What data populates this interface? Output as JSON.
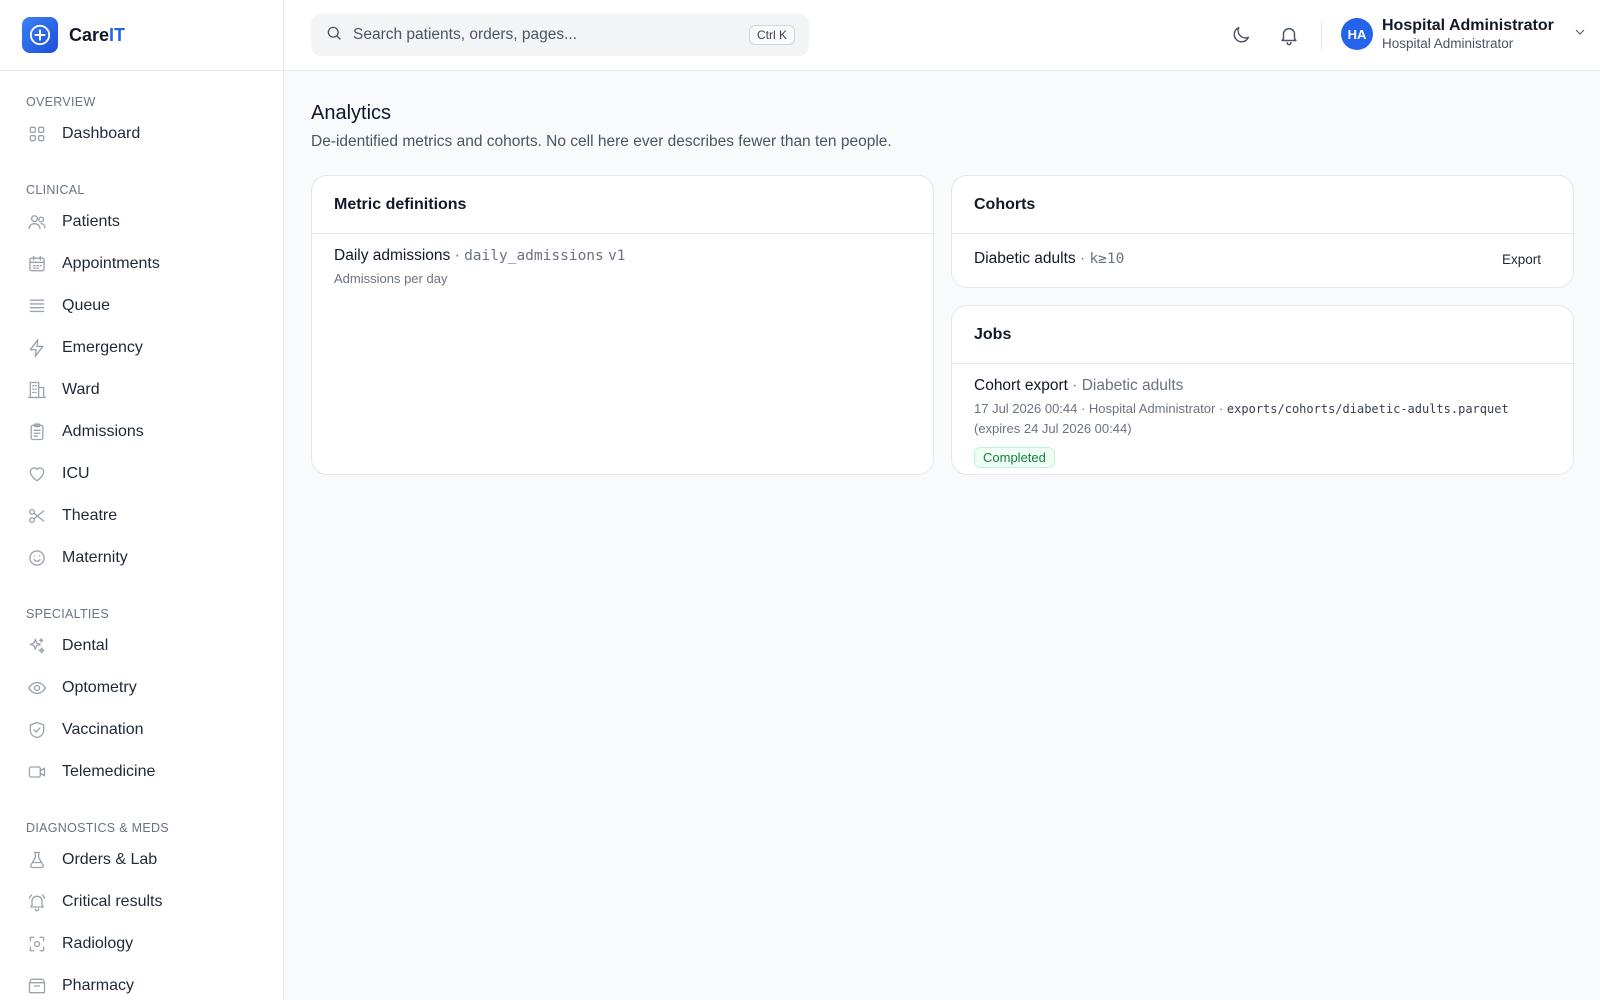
{
  "brand": {
    "name_main": "Care",
    "name_accent": "IT"
  },
  "search": {
    "placeholder": "Search patients, orders, pages...",
    "shortcut": "Ctrl K"
  },
  "user": {
    "initials": "HA",
    "name": "Hospital Administrator",
    "role": "Hospital Administrator"
  },
  "sidebar": {
    "sections": [
      {
        "title": "OVERVIEW",
        "items": [
          {
            "label": "Dashboard",
            "icon": "grid-icon"
          }
        ]
      },
      {
        "title": "CLINICAL",
        "items": [
          {
            "label": "Patients",
            "icon": "users-icon"
          },
          {
            "label": "Appointments",
            "icon": "calendar-icon"
          },
          {
            "label": "Queue",
            "icon": "list-icon"
          },
          {
            "label": "Emergency",
            "icon": "bolt-icon"
          },
          {
            "label": "Ward",
            "icon": "building-icon"
          },
          {
            "label": "Admissions",
            "icon": "clipboard-icon"
          },
          {
            "label": "ICU",
            "icon": "heart-icon"
          },
          {
            "label": "Theatre",
            "icon": "scissors-icon"
          },
          {
            "label": "Maternity",
            "icon": "smile-icon"
          }
        ]
      },
      {
        "title": "SPECIALTIES",
        "items": [
          {
            "label": "Dental",
            "icon": "sparkles-icon"
          },
          {
            "label": "Optometry",
            "icon": "eye-icon"
          },
          {
            "label": "Vaccination",
            "icon": "shield-check-icon"
          },
          {
            "label": "Telemedicine",
            "icon": "video-icon"
          }
        ]
      },
      {
        "title": "DIAGNOSTICS & MEDS",
        "items": [
          {
            "label": "Orders & Lab",
            "icon": "flask-icon"
          },
          {
            "label": "Critical results",
            "icon": "bell-alert-icon"
          },
          {
            "label": "Radiology",
            "icon": "scan-icon"
          },
          {
            "label": "Pharmacy",
            "icon": "box-icon"
          }
        ]
      }
    ]
  },
  "page": {
    "title": "Analytics",
    "subtitle": "De-identified metrics and cohorts. No cell here ever describes fewer than ten people."
  },
  "metrics": {
    "title": "Metric definitions",
    "items": [
      {
        "name": "Daily admissions",
        "sep": " · ",
        "key": "daily_admissions",
        "version": "v1",
        "description": "Admissions per day"
      }
    ]
  },
  "cohorts": {
    "title": "Cohorts",
    "items": [
      {
        "name": "Diabetic adults",
        "sep": " · ",
        "k": "k≥10",
        "action": "Export"
      }
    ]
  },
  "jobs": {
    "title": "Jobs",
    "items": [
      {
        "name": "Cohort export",
        "sep": " · ",
        "target": "Diabetic adults",
        "meta_prefix": "17 Jul 2026 00:44 · Hospital Administrator · ",
        "path": "exports/cohorts/diabetic-adults.parquet",
        "meta_suffix": " (expires 24 Jul 2026 00:44)",
        "status": "Completed"
      }
    ]
  },
  "colors": {
    "accent": "#2563eb",
    "success": "#15803d"
  }
}
